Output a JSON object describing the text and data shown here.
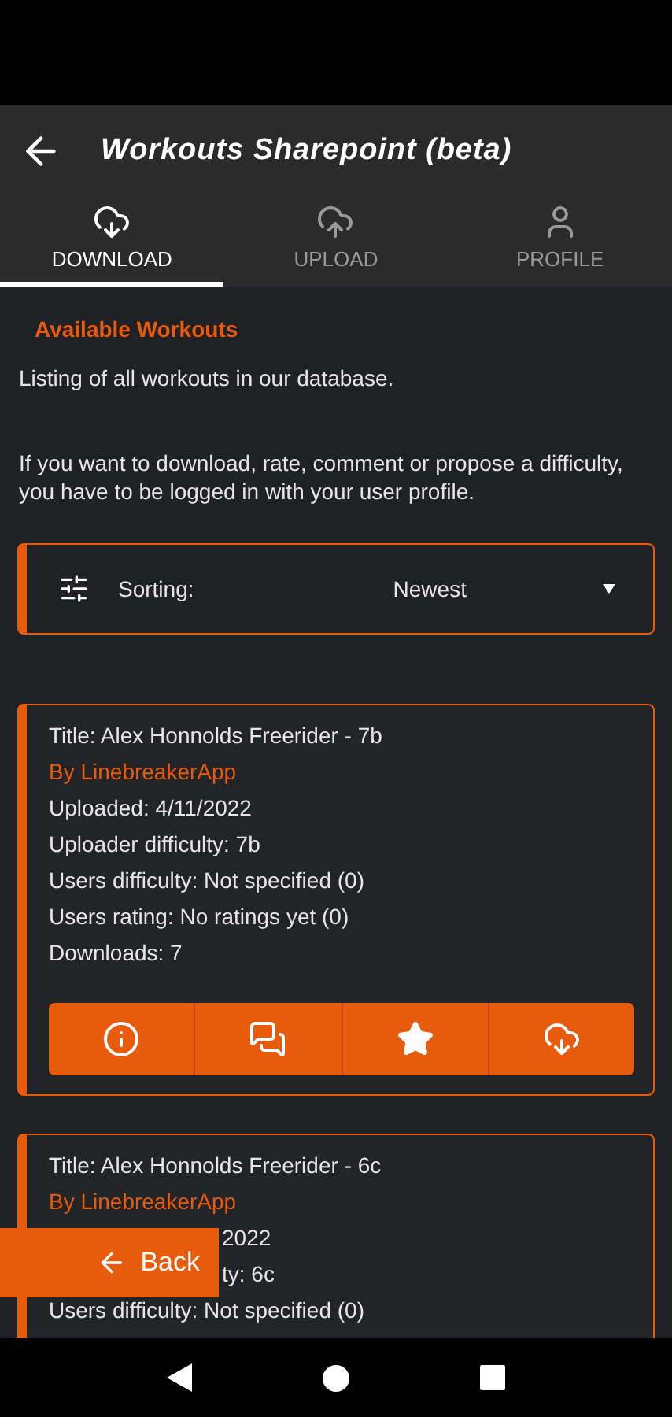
{
  "app_bar": {
    "title": "Workouts Sharepoint (beta)"
  },
  "tabs": [
    {
      "label": "DOWNLOAD",
      "kind": "download",
      "selected": true
    },
    {
      "label": "UPLOAD",
      "kind": "upload",
      "selected": false
    },
    {
      "label": "PROFILE",
      "kind": "profile",
      "selected": false
    }
  ],
  "section_title": "Available Workouts",
  "intro": [
    "Listing of all workouts in our database.",
    "If you want to download, rate, comment or propose a difficulty, you have to be logged in with your user profile."
  ],
  "sorting": {
    "label": "Sorting:",
    "value": "Newest"
  },
  "workouts": [
    {
      "title": "Title: Alex Honnolds Freerider - 7b",
      "author": "By LinebreakerApp",
      "details": [
        {
          "text": "Uploaded: 4/11/2022",
          "kind": "full"
        },
        {
          "text": "Uploader difficulty: 7b",
          "kind": "full"
        },
        {
          "text": "Users difficulty: Not specified (0)",
          "kind": "full"
        },
        {
          "text": "Users rating: No ratings yet (0)",
          "kind": "full"
        },
        {
          "text": "Downloads: 7",
          "kind": "full"
        }
      ],
      "actions": [
        {
          "kind": "info"
        },
        {
          "kind": "comments"
        },
        {
          "kind": "rate"
        },
        {
          "kind": "download"
        }
      ]
    },
    {
      "title": "Title: Alex Honnolds Freerider - 6c",
      "author": "By LinebreakerApp",
      "details": [
        {
          "text": "2022",
          "kind": "cut"
        },
        {
          "text": "ty: 6c",
          "kind": "cut"
        },
        {
          "text": "Users difficulty: Not specified (0)",
          "kind": "full"
        }
      ]
    }
  ],
  "back_button": {
    "label": "Back"
  }
}
